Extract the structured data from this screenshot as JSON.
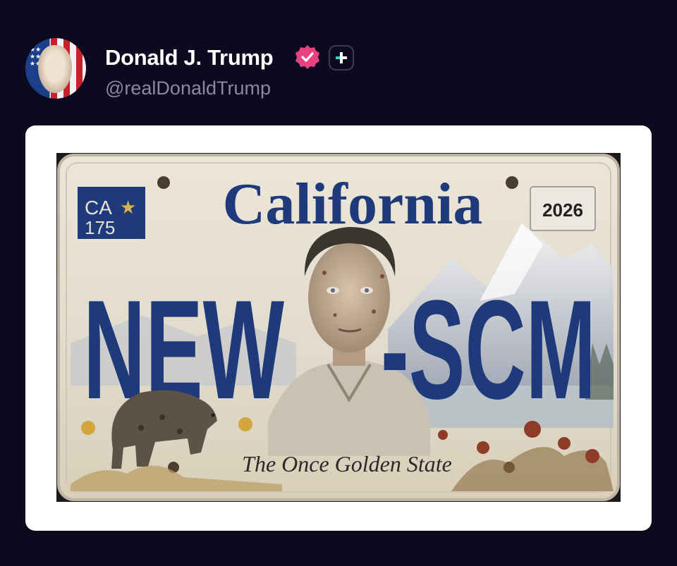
{
  "post": {
    "author": {
      "display_name": "Donald J. Trump",
      "handle": "@realDonaldTrump",
      "avatar_icon": "avatar-flag-portrait",
      "verified_icon": "verified-badge-icon",
      "verified_color": "#e8417f",
      "plus_icon": "plus-icon",
      "plus_color": "#2dd4bf"
    },
    "media": {
      "type": "image",
      "plate": {
        "state": "California",
        "badge_line1": "CA",
        "badge_line2": "175",
        "year": "2026",
        "left_text": "NEW",
        "right_text": "-SCM",
        "slogan": "The Once Golden State"
      }
    }
  },
  "colors": {
    "background": "#0c0a1e",
    "card": "#ffffff",
    "plate_blue": "#1e3a7a",
    "plate_base": "#e8e2d4"
  }
}
